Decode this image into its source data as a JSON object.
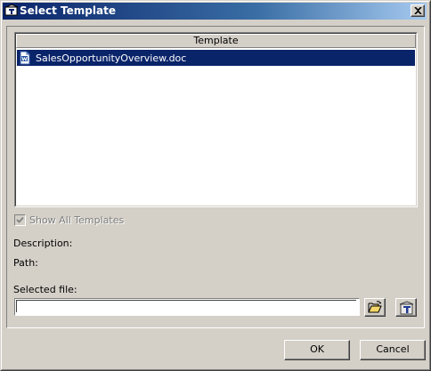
{
  "window": {
    "title": "Select Template",
    "close_label": "×"
  },
  "template_list": {
    "column_header": "Template",
    "items": [
      {
        "name": "SalesOpportunityOverview.doc",
        "icon": "word-document-icon",
        "selected": true
      }
    ]
  },
  "show_all": {
    "label": "Show All Templates",
    "checked": true,
    "disabled": true
  },
  "details": {
    "description_label": "Description:",
    "path_label": "Path:"
  },
  "selected_file": {
    "label": "Selected file:",
    "value": "",
    "browse_icon": "open-folder-icon",
    "template_icon": "template-icon"
  },
  "buttons": {
    "ok": "OK",
    "cancel": "Cancel"
  },
  "colors": {
    "selection": "#0a246a",
    "titlebar_start": "#0a246a",
    "titlebar_end": "#a6caf0",
    "face": "#d4d0c8"
  }
}
